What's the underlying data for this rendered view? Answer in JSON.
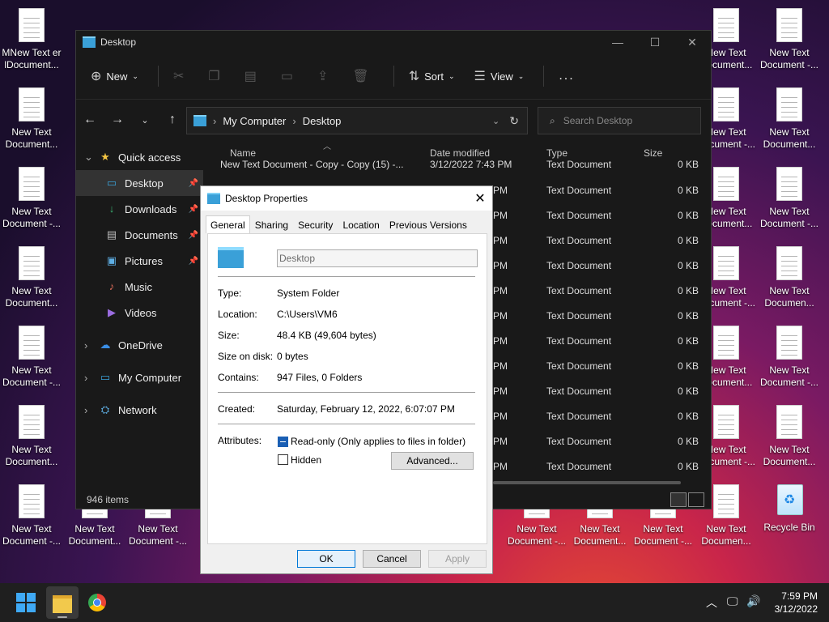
{
  "desktop": {
    "icons_left": [
      {
        "label": "MNew Text er lDocument..."
      },
      {
        "label": "New Text Document..."
      },
      {
        "label": "New Text Document -..."
      },
      {
        "label": "New Text Document..."
      },
      {
        "label": "New Text Document -..."
      },
      {
        "label": "New Text Document..."
      },
      {
        "label": "New Text Document -..."
      }
    ],
    "icons_right_col1": [
      {
        "label": "New Text Document..."
      },
      {
        "label": "New Text Document -..."
      },
      {
        "label": "New Text Document..."
      },
      {
        "label": "New Text Document -..."
      },
      {
        "label": "New Text Document..."
      },
      {
        "label": "New Text Document -..."
      },
      {
        "label": "New Text Documen..."
      }
    ],
    "icons_right_col2": [
      {
        "label": "New Text Document -..."
      },
      {
        "label": "New Text Document..."
      },
      {
        "label": "New Text Document -..."
      },
      {
        "label": "New Text Documen..."
      },
      {
        "label": "New Text Document -..."
      },
      {
        "label": "New Text Document..."
      },
      {
        "label": "Recycle Bin"
      }
    ],
    "bottom_row": [
      {
        "label": "New Text Document..."
      },
      {
        "label": "New Text Document -..."
      },
      {
        "label": "New Text Document -..."
      },
      {
        "label": "New Text Document..."
      },
      {
        "label": "New Text Document -..."
      }
    ]
  },
  "explorer": {
    "title": "Desktop",
    "toolbar": {
      "new_label": "New",
      "sort_label": "Sort",
      "view_label": "View",
      "more_label": "..."
    },
    "breadcrumb": {
      "root": "My Computer",
      "current": "Desktop"
    },
    "search_placeholder": "Search Desktop",
    "sidebar": [
      {
        "label": "Quick access",
        "icon": "star-icon"
      },
      {
        "label": "Desktop",
        "icon": "desktop-icon"
      },
      {
        "label": "Downloads",
        "icon": "download-icon"
      },
      {
        "label": "Documents",
        "icon": "documents-icon"
      },
      {
        "label": "Pictures",
        "icon": "pictures-icon"
      },
      {
        "label": "Music",
        "icon": "music-icon"
      },
      {
        "label": "Videos",
        "icon": "videos-icon"
      },
      {
        "label": "OneDrive",
        "icon": "cloud-icon"
      },
      {
        "label": "My Computer",
        "icon": "computer-icon"
      },
      {
        "label": "Network",
        "icon": "network-icon"
      }
    ],
    "columns": {
      "name": "Name",
      "date": "Date modified",
      "type": "Type",
      "size": "Size"
    },
    "first_row": {
      "name": "New Text Document - Copy - Copy (15) -...",
      "date": "3/12/2022 7:43 PM",
      "type": "Text Document",
      "size": "0 KB"
    },
    "rows": [
      {
        "date": "PM",
        "type": "Text Document",
        "size": "0 KB"
      },
      {
        "date": "PM",
        "type": "Text Document",
        "size": "0 KB"
      },
      {
        "date": "PM",
        "type": "Text Document",
        "size": "0 KB"
      },
      {
        "date": "PM",
        "type": "Text Document",
        "size": "0 KB"
      },
      {
        "date": "PM",
        "type": "Text Document",
        "size": "0 KB"
      },
      {
        "date": "PM",
        "type": "Text Document",
        "size": "0 KB"
      },
      {
        "date": "PM",
        "type": "Text Document",
        "size": "0 KB"
      },
      {
        "date": "PM",
        "type": "Text Document",
        "size": "0 KB"
      },
      {
        "date": "PM",
        "type": "Text Document",
        "size": "0 KB"
      },
      {
        "date": "PM",
        "type": "Text Document",
        "size": "0 KB"
      },
      {
        "date": "PM",
        "type": "Text Document",
        "size": "0 KB"
      },
      {
        "date": "PM",
        "type": "Text Document",
        "size": "0 KB"
      }
    ],
    "status": "946 items"
  },
  "dialog": {
    "title": "Desktop Properties",
    "tabs": [
      "General",
      "Sharing",
      "Security",
      "Location",
      "Previous Versions"
    ],
    "name_value": "Desktop",
    "props": {
      "type_label": "Type:",
      "type_value": "System Folder",
      "location_label": "Location:",
      "location_value": "C:\\Users\\VM6",
      "size_label": "Size:",
      "size_value": "48.4 KB (49,604 bytes)",
      "size_on_disk_label": "Size on disk:",
      "size_on_disk_value": "0 bytes",
      "contains_label": "Contains:",
      "contains_value": "947 Files, 0 Folders",
      "created_label": "Created:",
      "created_value": "Saturday, February 12, 2022, 6:07:07 PM",
      "attributes_label": "Attributes:",
      "readonly_label": "Read-only (Only applies to files in folder)",
      "hidden_label": "Hidden",
      "advanced_label": "Advanced..."
    },
    "buttons": {
      "ok": "OK",
      "cancel": "Cancel",
      "apply": "Apply"
    }
  },
  "taskbar": {
    "time": "7:59 PM",
    "date": "3/12/2022"
  }
}
